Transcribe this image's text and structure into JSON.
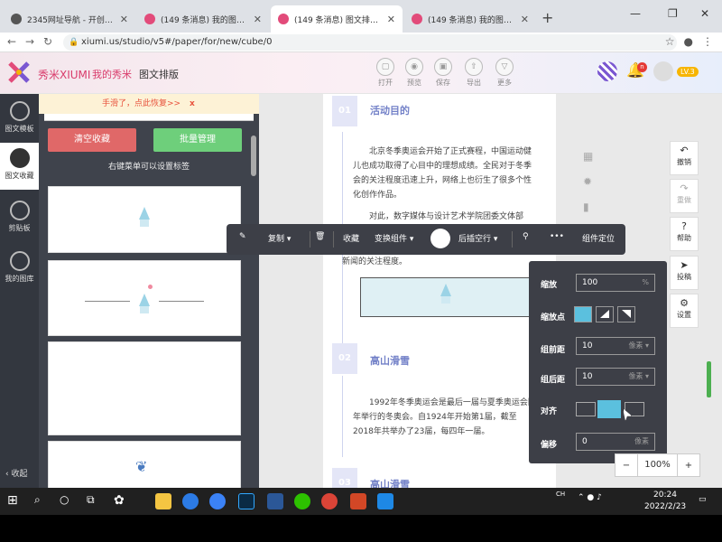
{
  "browser": {
    "tabs": [
      {
        "label": "2345网址导航 - 开创中国百年品"
      },
      {
        "label": "(149 条消息) 我的图文 - 秀米XI"
      },
      {
        "label": "(149 条消息) 图文排版 - 秀米XI"
      },
      {
        "label": "(149 条消息) 我的图文 - 秀米XI"
      }
    ],
    "url": "xiumi.us/studio/v5#/paper/for/new/cube/0"
  },
  "app": {
    "brand": "秀米XIUMI",
    "nav_mine": "我的秀米",
    "nav_current": "图文排版",
    "tools": [
      {
        "label": "打开"
      },
      {
        "label": "预览"
      },
      {
        "label": "保存"
      },
      {
        "label": "导出"
      },
      {
        "label": "更多"
      }
    ],
    "notif_badge": "n",
    "level": "LV.3"
  },
  "leftbar": {
    "items": [
      {
        "label": "图文模板"
      },
      {
        "label": "图文收藏"
      },
      {
        "label": "剪贴板"
      },
      {
        "label": "我的图库"
      }
    ],
    "collapse": "收起"
  },
  "leftpanel": {
    "restore_text": "手滑了，点此恢复>>",
    "restore_close": "x",
    "clear_btn": "清空收藏",
    "batch_btn": "批量管理",
    "hint": "右键菜单可以设置标签"
  },
  "page": {
    "sections": [
      {
        "num": "01",
        "title": "活动目的"
      },
      {
        "num": "02",
        "title": "高山滑雪"
      },
      {
        "num": "03",
        "title": "高山滑雪"
      }
    ],
    "para1a": "北京冬季奥运会开始了正式赛程，中国运动健儿也成功取得了心目中的理想成绩。全民对于冬季会的关注程度迅速上升，网络上也衍生了很多个性化创作作品。",
    "para1b": "对此，数字媒体与设计艺术学院团委文体部",
    "para1c": "新闻的关注程度。",
    "para2": "1992年冬季奥运会是最后一届与夏季奥运会同年举行的冬奥会。自1924年开始第1届，截至2018年共举办了23届，每四年一届。"
  },
  "ftoolbar": {
    "copy": "复制",
    "collect": "收藏",
    "transform": "变换组件",
    "insert_after": "后插空行",
    "more": "•••",
    "locate": "组件定位"
  },
  "props": {
    "scale_label": "缩放",
    "scale_value": "100",
    "scale_unit": "%",
    "scale_point_label": "缩放点",
    "margin_before_label": "组前距",
    "margin_before_value": "10",
    "margin_before_unit": "像素",
    "margin_after_label": "组后距",
    "margin_after_value": "10",
    "margin_after_unit": "像素",
    "align_label": "对齐",
    "offset_label": "偏移",
    "offset_value": "0",
    "offset_unit": "像素"
  },
  "righttools": [
    {
      "glyph": "↶",
      "label": "撤销"
    },
    {
      "glyph": "↷",
      "label": "重做"
    },
    {
      "glyph": "?",
      "label": "帮助"
    },
    {
      "glyph": "➤",
      "label": "投稿"
    },
    {
      "glyph": "⚙",
      "label": "设置"
    }
  ],
  "zoom": {
    "minus": "−",
    "value": "100%",
    "plus": "+"
  },
  "taskbar": {
    "ime": "CH",
    "time": "20:24",
    "date": "2022/2/23"
  }
}
